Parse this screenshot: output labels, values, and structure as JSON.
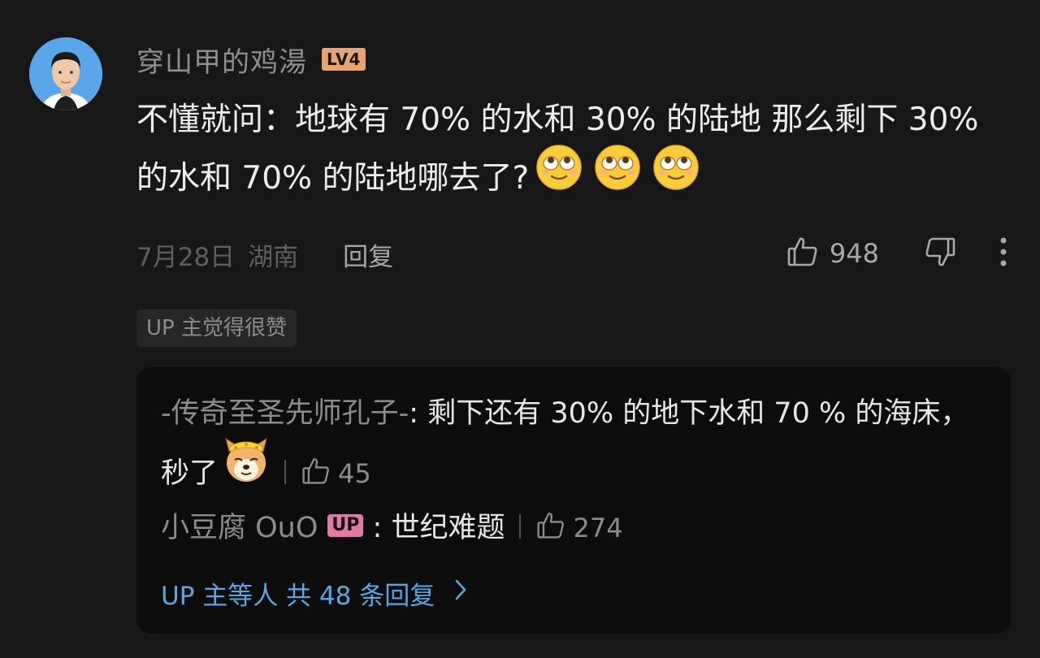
{
  "comment": {
    "username": "穿山甲的鸡湯",
    "level": "LV4",
    "text": "不懂就问：地球有 70% 的水和 30% 的陆地 那么剩下 30% 的水和 70% 的陆地哪去了?",
    "date": "7月28日",
    "location": "湖南",
    "reply_label": "回复",
    "like_count": "948",
    "up_tag": "UP 主觉得很赞"
  },
  "replies": [
    {
      "author": "-传奇至圣先师孔子-",
      "separator": ": ",
      "text": "剩下还有 30% 的地下水和 70 % 的海床，秒了",
      "like_count": "45"
    },
    {
      "author": "小豆腐 OuO",
      "badge": "UP",
      "separator": " : ",
      "text": "世纪难题",
      "like_count": "274"
    }
  ],
  "more_replies": "UP 主等人 共 48 条回复",
  "icons": {
    "avatar": "avatar-photo",
    "like": "thumbs-up-icon",
    "dislike": "thumbs-down-icon",
    "more": "more-vertical-icon",
    "chevron": "chevron-right-icon",
    "emoji": "rolling-eyes-emoji",
    "doge": "doge-emoji"
  },
  "colors": {
    "background": "#171717",
    "reply_box": "#0c0c0c",
    "level_badge": "#e9a36c",
    "up_badge": "#e37aa6",
    "link": "#58a7e0"
  }
}
